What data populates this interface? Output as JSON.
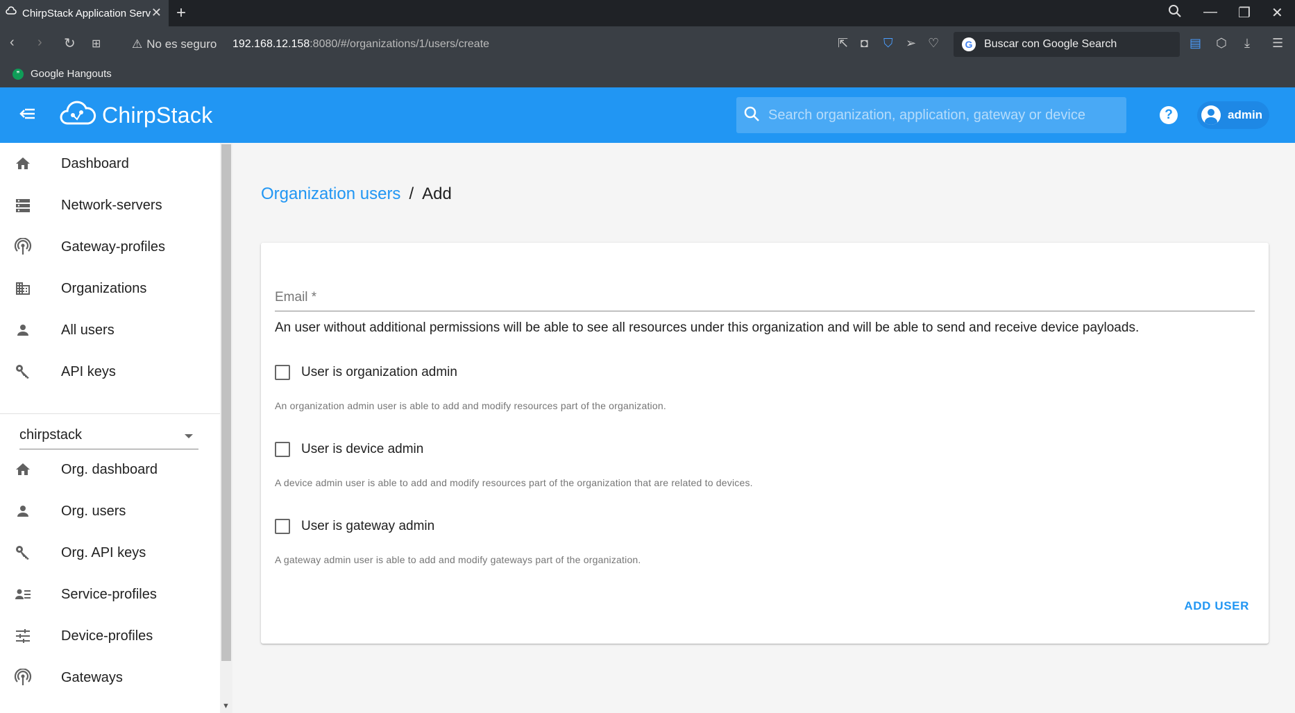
{
  "browser": {
    "tab_title": "ChirpStack Application Server",
    "security_label": "No es seguro",
    "url_host": "192.168.12.158",
    "url_rest": ":8080/#/organizations/1/users/create",
    "search_engine_label": "Buscar con Google Search",
    "bookmark": "Google Hangouts"
  },
  "header": {
    "logo_text": "ChirpStack",
    "search_placeholder": "Search organization, application, gateway or device",
    "user": "admin",
    "help_glyph": "?"
  },
  "sidebar": {
    "global_items": [
      {
        "label": "Dashboard",
        "icon": "home-icon"
      },
      {
        "label": "Network-servers",
        "icon": "server-icon"
      },
      {
        "label": "Gateway-profiles",
        "icon": "radio-tower-icon"
      },
      {
        "label": "Organizations",
        "icon": "domain-icon"
      },
      {
        "label": "All users",
        "icon": "user-icon"
      },
      {
        "label": "API keys",
        "icon": "key-icon"
      }
    ],
    "org_selected": "chirpstack",
    "org_items": [
      {
        "label": "Org. dashboard",
        "icon": "home-icon"
      },
      {
        "label": "Org. users",
        "icon": "user-icon"
      },
      {
        "label": "Org. API keys",
        "icon": "key-icon"
      },
      {
        "label": "Service-profiles",
        "icon": "account-details-icon"
      },
      {
        "label": "Device-profiles",
        "icon": "tune-icon"
      },
      {
        "label": "Gateways",
        "icon": "radio-tower-icon"
      }
    ]
  },
  "breadcrumb": {
    "link": "Organization users",
    "separator": "/",
    "current": "Add"
  },
  "form": {
    "email_label": "Email *",
    "info": "An user without additional permissions will be able to see all resources under this organization and will be able to send and receive device payloads.",
    "checkboxes": [
      {
        "label": "User is organization admin",
        "help": "An organization admin user is able to add and modify resources part of the organization."
      },
      {
        "label": "User is device admin",
        "help": "A device admin user is able to add and modify resources part of the organization that are related to devices."
      },
      {
        "label": "User is gateway admin",
        "help": "A gateway admin user is able to add and modify gateways part of the organization."
      }
    ],
    "submit_label": "ADD USER"
  },
  "colors": {
    "primary": "#2196f3",
    "browser_dark": "#3a3f45"
  }
}
